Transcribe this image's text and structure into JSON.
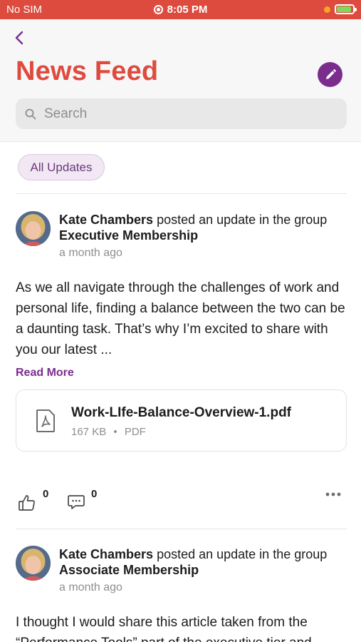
{
  "status_bar": {
    "carrier": "No SIM",
    "time": "8:05 PM"
  },
  "header": {
    "title": "News Feed"
  },
  "search": {
    "placeholder": "Search"
  },
  "filter": {
    "label": "All Updates"
  },
  "colors": {
    "brand_red": "#dd4b3e",
    "accent_purple": "#7b2d8e"
  },
  "posts": [
    {
      "author": "Kate Chambers",
      "action": "posted an update in the group",
      "group": "Executive Membership",
      "time": "a month ago",
      "body": "As we all navigate through the challenges of work and personal life, finding a balance between the two can be a daunting task. That’s why I’m excited to share with you our latest ...",
      "read_more": "Read More",
      "attachment": {
        "name": "Work-LIfe-Balance-Overview-1.pdf",
        "size": "167 KB",
        "separator": "•",
        "type": "PDF",
        "icon": "pdf-file-icon"
      },
      "likes": "0",
      "comments": "0"
    },
    {
      "author": "Kate Chambers",
      "action": "posted an update in the group",
      "group": "Associate Membership",
      "time": "a month ago",
      "body": "I thought I would share this article taken from the “Performance Tools” part of the executive tier and"
    }
  ]
}
